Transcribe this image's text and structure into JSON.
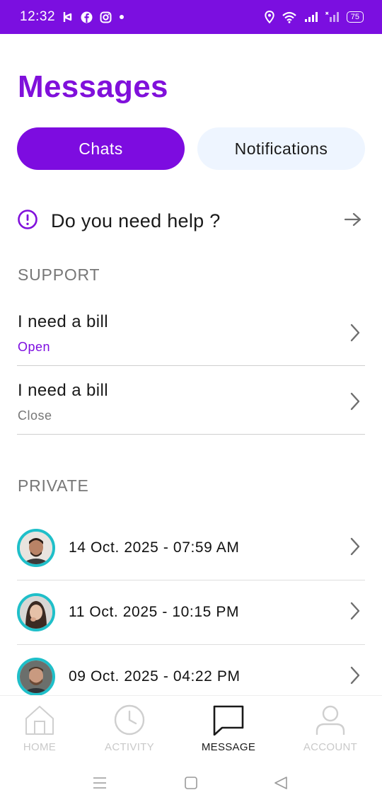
{
  "status_bar": {
    "time": "12:32",
    "battery": "75",
    "background": "#7b0fe0"
  },
  "header": {
    "title": "Messages"
  },
  "tabs": {
    "chats": "Chats",
    "notifications": "Notifications",
    "active": "chats"
  },
  "help": {
    "label": "Do you need help ?"
  },
  "support": {
    "header": "SUPPORT",
    "items": [
      {
        "title": "I need a bill",
        "status": "Open"
      },
      {
        "title": "I need a bill",
        "status": "Close"
      }
    ]
  },
  "private": {
    "header": "PRIVATE",
    "items": [
      {
        "date": "14 Oct. 2025 - 07:59 AM"
      },
      {
        "date": "11 Oct. 2025 - 10:15 PM"
      },
      {
        "date": "09 Oct. 2025 - 04:22 PM"
      }
    ]
  },
  "bottom_nav": {
    "items": [
      {
        "label": "HOME",
        "icon": "home-icon"
      },
      {
        "label": "ACTIVITY",
        "icon": "clock-icon"
      },
      {
        "label": "MESSAGE",
        "icon": "message-icon"
      },
      {
        "label": "ACCOUNT",
        "icon": "account-icon"
      }
    ],
    "active": "MESSAGE"
  },
  "colors": {
    "accent": "#7d0ce0",
    "avatar_ring": "#1fbfc9",
    "tab_inactive_bg": "#eef5ff"
  }
}
